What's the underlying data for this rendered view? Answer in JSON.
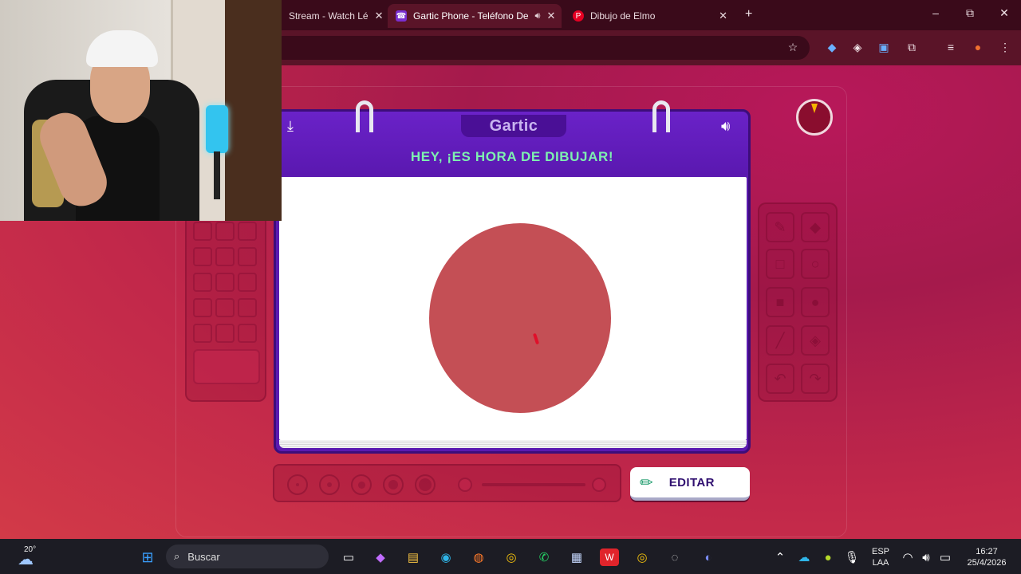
{
  "browser": {
    "tabs": [
      {
        "title": "Stream - Watch Lé",
        "active": false
      },
      {
        "title": "Gartic Phone - Teléfono De",
        "active": true
      },
      {
        "title": "Dibujo de Elmo",
        "active": false
      }
    ],
    "close_glyph": "✕",
    "new_tab_glyph": "+",
    "window_controls": {
      "minimize": "–",
      "restore": "⧉",
      "close": "✕"
    }
  },
  "game": {
    "logo": "Gartic",
    "title": "HEY, ¡ES HORA DE DIBUJAR!",
    "edit_button_label": "EDITAR",
    "colors": {
      "drawn_circle": "#c44f55",
      "header_purple": "#5b1ab0",
      "title_green": "#7ef0b0"
    }
  },
  "taskbar": {
    "weather_temp": "20°",
    "search_placeholder": "Buscar",
    "language_line1": "ESP",
    "language_line2": "LAA",
    "time": "16:27",
    "date": "25/4/2026"
  }
}
